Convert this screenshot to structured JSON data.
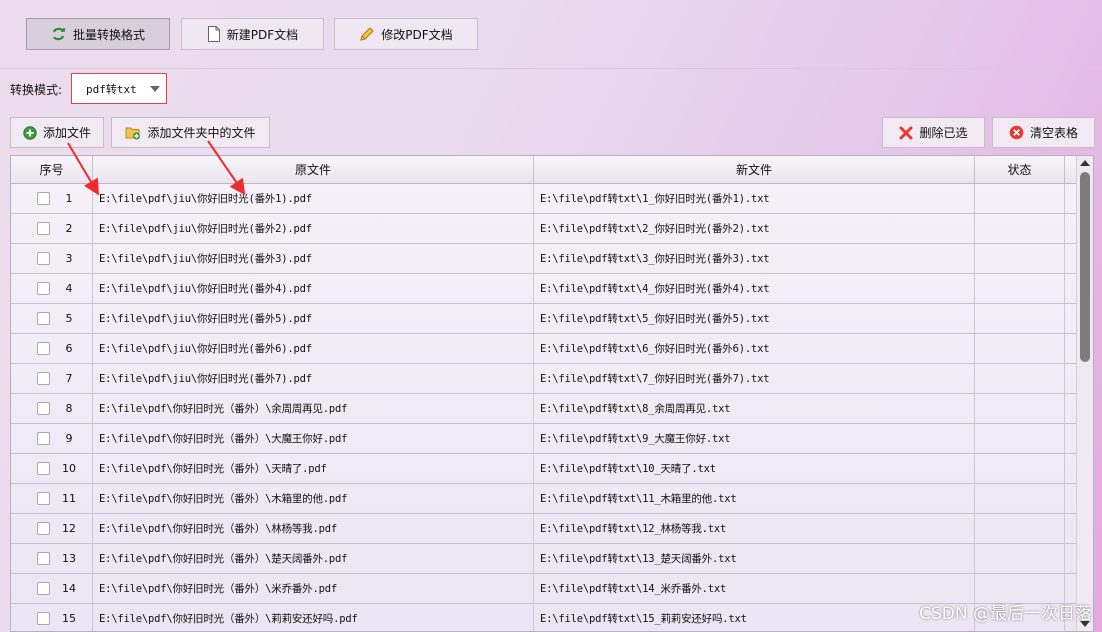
{
  "tabs": [
    {
      "label": "批量转换格式",
      "icon": "convert-icon"
    },
    {
      "label": "新建PDF文档",
      "icon": "document-icon"
    },
    {
      "label": "修改PDF文档",
      "icon": "pencil-icon"
    }
  ],
  "mode": {
    "label": "转换模式:",
    "value": "pdf转txt"
  },
  "toolbar": {
    "add_file": "添加文件",
    "add_folder": "添加文件夹中的文件",
    "delete_selected": "删除已选",
    "clear_table": "清空表格"
  },
  "table": {
    "columns": [
      "序号",
      "原文件",
      "新文件",
      "状态"
    ],
    "rows": [
      {
        "seq": "1",
        "src": "E:\\file\\pdf\\jiu\\你好旧时光(番外1).pdf",
        "dst": "E:\\file\\pdf转txt\\1_你好旧时光(番外1).txt",
        "status": ""
      },
      {
        "seq": "2",
        "src": "E:\\file\\pdf\\jiu\\你好旧时光(番外2).pdf",
        "dst": "E:\\file\\pdf转txt\\2_你好旧时光(番外2).txt",
        "status": ""
      },
      {
        "seq": "3",
        "src": "E:\\file\\pdf\\jiu\\你好旧时光(番外3).pdf",
        "dst": "E:\\file\\pdf转txt\\3_你好旧时光(番外3).txt",
        "status": ""
      },
      {
        "seq": "4",
        "src": "E:\\file\\pdf\\jiu\\你好旧时光(番外4).pdf",
        "dst": "E:\\file\\pdf转txt\\4_你好旧时光(番外4).txt",
        "status": ""
      },
      {
        "seq": "5",
        "src": "E:\\file\\pdf\\jiu\\你好旧时光(番外5).pdf",
        "dst": "E:\\file\\pdf转txt\\5_你好旧时光(番外5).txt",
        "status": ""
      },
      {
        "seq": "6",
        "src": "E:\\file\\pdf\\jiu\\你好旧时光(番外6).pdf",
        "dst": "E:\\file\\pdf转txt\\6_你好旧时光(番外6).txt",
        "status": ""
      },
      {
        "seq": "7",
        "src": "E:\\file\\pdf\\jiu\\你好旧时光(番外7).pdf",
        "dst": "E:\\file\\pdf转txt\\7_你好旧时光(番外7).txt",
        "status": ""
      },
      {
        "seq": "8",
        "src": "E:\\file\\pdf\\你好旧时光（番外）\\余周周再见.pdf",
        "dst": "E:\\file\\pdf转txt\\8_余周周再见.txt",
        "status": ""
      },
      {
        "seq": "9",
        "src": "E:\\file\\pdf\\你好旧时光（番外）\\大魔王你好.pdf",
        "dst": "E:\\file\\pdf转txt\\9_大魔王你好.txt",
        "status": ""
      },
      {
        "seq": "10",
        "src": "E:\\file\\pdf\\你好旧时光（番外）\\天晴了.pdf",
        "dst": "E:\\file\\pdf转txt\\10_天晴了.txt",
        "status": ""
      },
      {
        "seq": "11",
        "src": "E:\\file\\pdf\\你好旧时光（番外）\\木箱里的他.pdf",
        "dst": "E:\\file\\pdf转txt\\11_木箱里的他.txt",
        "status": ""
      },
      {
        "seq": "12",
        "src": "E:\\file\\pdf\\你好旧时光（番外）\\林杨等我.pdf",
        "dst": "E:\\file\\pdf转txt\\12_林杨等我.txt",
        "status": ""
      },
      {
        "seq": "13",
        "src": "E:\\file\\pdf\\你好旧时光（番外）\\楚天阔番外.pdf",
        "dst": "E:\\file\\pdf转txt\\13_楚天阔番外.txt",
        "status": ""
      },
      {
        "seq": "14",
        "src": "E:\\file\\pdf\\你好旧时光（番外）\\米乔番外.pdf",
        "dst": "E:\\file\\pdf转txt\\14_米乔番外.txt",
        "status": ""
      },
      {
        "seq": "15",
        "src": "E:\\file\\pdf\\你好旧时光（番外）\\莉莉安还好吗.pdf",
        "dst": "E:\\file\\pdf转txt\\15_莉莉安还好吗.txt",
        "status": ""
      }
    ]
  },
  "watermark": "CSDN @最后一次日落",
  "colors": {
    "accent_red": "#e53935",
    "add_green": "#3a9d3a"
  }
}
